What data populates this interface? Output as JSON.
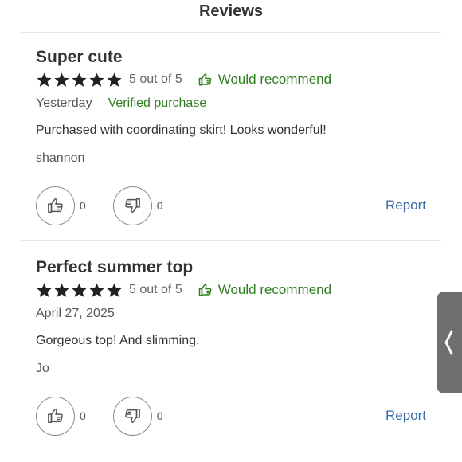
{
  "header": {
    "title": "Reviews"
  },
  "reviews": [
    {
      "title": "Super cute",
      "rating_text": "5 out of 5",
      "stars": 5,
      "recommend": "Would recommend",
      "date": "Yesterday",
      "verified": "Verified purchase",
      "body": "Purchased with coordinating skirt! Looks wonderful!",
      "author": "shannon",
      "helpful_count": "0",
      "unhelpful_count": "0",
      "report": "Report"
    },
    {
      "title": "Perfect summer top",
      "rating_text": "5 out of 5",
      "stars": 5,
      "recommend": "Would recommend",
      "date": "April 27, 2025",
      "body": "Gorgeous top! And slimming.",
      "author": "Jo",
      "helpful_count": "0",
      "unhelpful_count": "0",
      "report": "Report"
    }
  ],
  "icons": {
    "star": "star-icon",
    "recommend": "thumbs-up-icon",
    "helpful": "thumbs-up-icon",
    "unhelpful": "thumbs-down-icon",
    "side_tab": "chevron-left-icon"
  },
  "colors": {
    "green": "#2e7d1f",
    "link": "#3a6ea5",
    "star": "#222222"
  }
}
